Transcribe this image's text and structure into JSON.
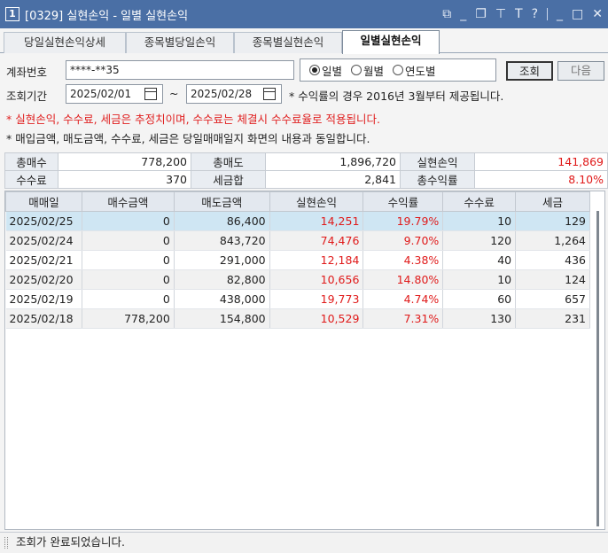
{
  "window": {
    "number": "1",
    "title": "[0329] 실현손익 - 일별 실현손익"
  },
  "tabs": [
    "당일실현손익상세",
    "종목별당일손익",
    "종목별실현손익",
    "일별실현손익"
  ],
  "form": {
    "account_label": "계좌번호",
    "account_value": "****-**35",
    "period_label": "조회기간",
    "date_from": "2025/02/01",
    "date_sep": "~",
    "date_to": "2025/02/28",
    "radio_daily": "일별",
    "radio_monthly": "월별",
    "radio_yearly": "연도별",
    "search_button": "조회",
    "next_button": "다음",
    "period_note": "* 수익률의 경우 2016년 3월부터 제공됩니다."
  },
  "notices": {
    "red": "* 실현손익, 수수료, 세금은 추정치이며, 수수료는 체결시 수수료율로 적용됩니다.",
    "black": "* 매입금액, 매도금액, 수수료, 세금은 당일매매일지 화면의 내용과 동일합니다."
  },
  "summary": {
    "buy_total_label": "총매수",
    "buy_total": "778,200",
    "sell_total_label": "총매도",
    "sell_total": "1,896,720",
    "realized_label": "실현손익",
    "realized": "141,869",
    "fee_label": "수수료",
    "fee": "370",
    "tax_label": "세금합",
    "tax": "2,841",
    "return_label": "총수익률",
    "return": "8.10%"
  },
  "grid": {
    "columns": [
      "매매일",
      "매수금액",
      "매도금액",
      "실현손익",
      "수익률",
      "수수료",
      "세금"
    ],
    "rows": [
      [
        "2025/02/25",
        "0",
        "86,400",
        "14,251",
        "19.79%",
        "10",
        "129"
      ],
      [
        "2025/02/24",
        "0",
        "843,720",
        "74,476",
        "9.70%",
        "120",
        "1,264"
      ],
      [
        "2025/02/21",
        "0",
        "291,000",
        "12,184",
        "4.38%",
        "40",
        "436"
      ],
      [
        "2025/02/20",
        "0",
        "82,800",
        "10,656",
        "14.80%",
        "10",
        "124"
      ],
      [
        "2025/02/19",
        "0",
        "438,000",
        "19,773",
        "4.74%",
        "60",
        "657"
      ],
      [
        "2025/02/18",
        "778,200",
        "154,800",
        "10,529",
        "7.31%",
        "130",
        "231"
      ]
    ]
  },
  "status": "조회가 완료되었습니다.",
  "colors": {
    "titlebar": "#4a6fa5",
    "profit_red": "#e01a1a",
    "selected_row": "#cfe6f3"
  }
}
